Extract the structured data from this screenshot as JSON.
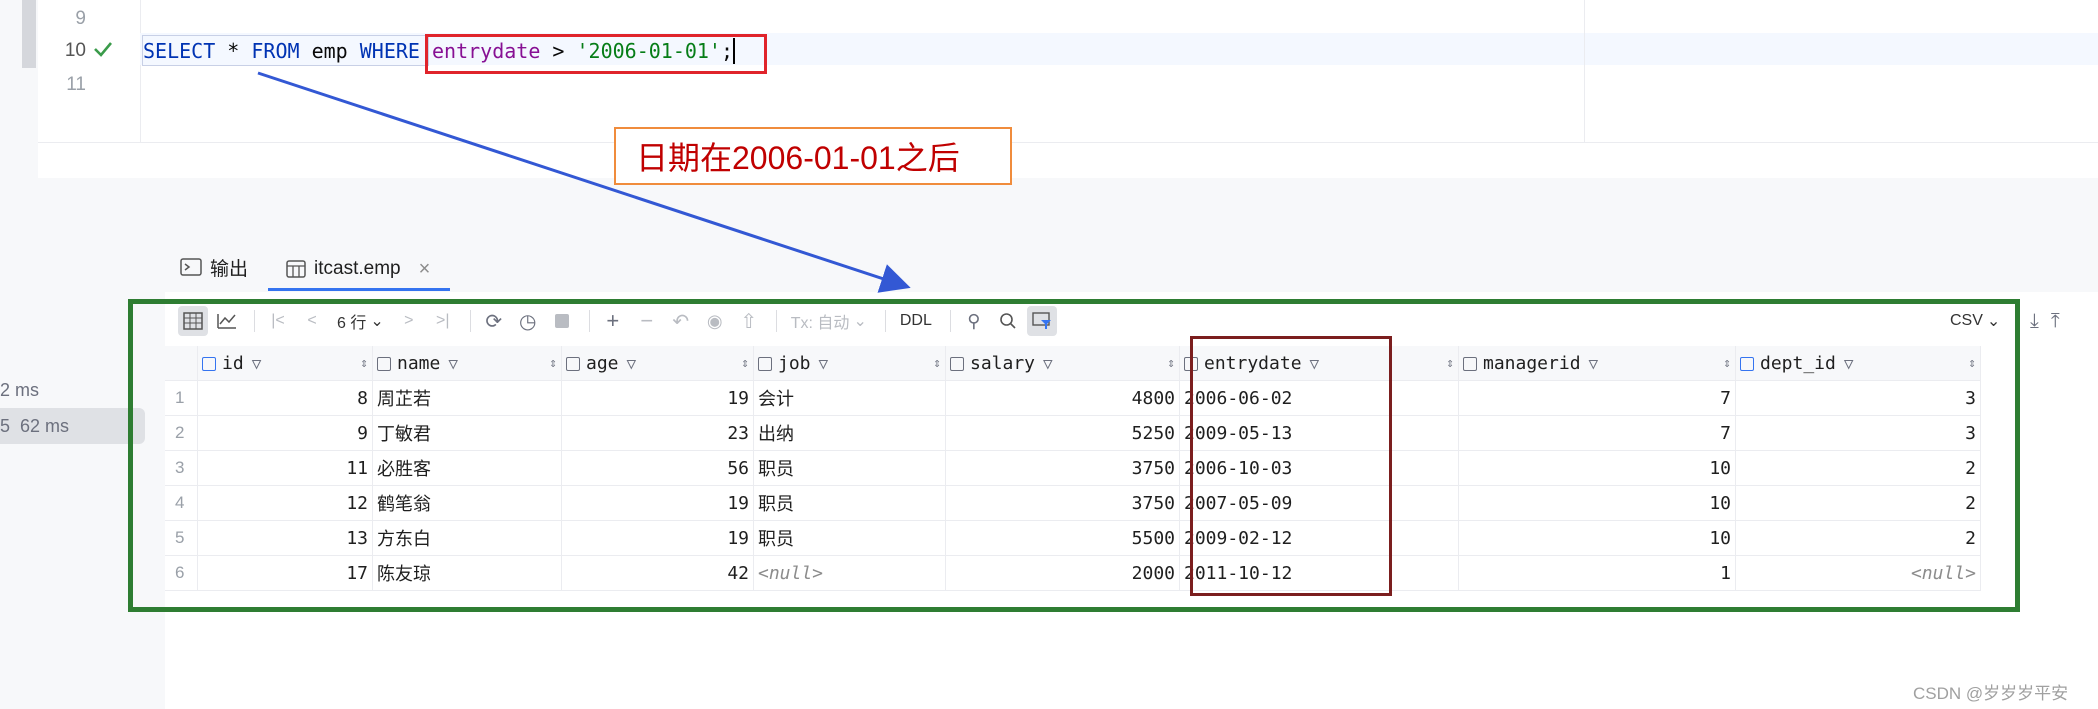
{
  "editor": {
    "line_numbers": [
      "9",
      "10",
      "11"
    ],
    "sql": {
      "kw_select": "SELECT",
      "star": " * ",
      "kw_from": "FROM",
      "table": " emp ",
      "kw_where": "WHERE",
      "column": "entrydate",
      "op": " > ",
      "literal": "'2006-01-01'",
      "semicolon": ";"
    },
    "run_status": "check-icon"
  },
  "annotation": {
    "text": "日期在2006-01-01之后"
  },
  "tabs": {
    "output_label": "输出",
    "result_label": "itcast.emp",
    "close_glyph": "×"
  },
  "side": {
    "time1": "2 ms",
    "time2": "5  62 ms"
  },
  "toolbar": {
    "rows_label": "6 行",
    "tx_label": "Tx: 自动",
    "ddl_label": "DDL",
    "export_label": "CSV"
  },
  "grid": {
    "columns": [
      {
        "name": "id",
        "key": "id"
      },
      {
        "name": "name",
        "key": "name"
      },
      {
        "name": "age",
        "key": "age"
      },
      {
        "name": "job",
        "key": "job"
      },
      {
        "name": "salary",
        "key": "salary"
      },
      {
        "name": "entrydate",
        "key": "entrydate"
      },
      {
        "name": "managerid",
        "key": "managerid"
      },
      {
        "name": "dept_id",
        "key": "dept_id"
      }
    ],
    "rows": [
      {
        "rn": "1",
        "id": "8",
        "name": "周芷若",
        "age": "19",
        "job": "会计",
        "salary": "4800",
        "entrydate": "2006-06-02",
        "managerid": "7",
        "dept_id": "3"
      },
      {
        "rn": "2",
        "id": "9",
        "name": "丁敏君",
        "age": "23",
        "job": "出纳",
        "salary": "5250",
        "entrydate": "2009-05-13",
        "managerid": "7",
        "dept_id": "3"
      },
      {
        "rn": "3",
        "id": "11",
        "name": "必胜客",
        "age": "56",
        "job": "职员",
        "salary": "3750",
        "entrydate": "2006-10-03",
        "managerid": "10",
        "dept_id": "2"
      },
      {
        "rn": "4",
        "id": "12",
        "name": "鹤笔翁",
        "age": "19",
        "job": "职员",
        "salary": "3750",
        "entrydate": "2007-05-09",
        "managerid": "10",
        "dept_id": "2"
      },
      {
        "rn": "5",
        "id": "13",
        "name": "方东白",
        "age": "19",
        "job": "职员",
        "salary": "5500",
        "entrydate": "2009-02-12",
        "managerid": "10",
        "dept_id": "2"
      },
      {
        "rn": "6",
        "id": "17",
        "name": "陈友琼",
        "age": "42",
        "job": "<null>",
        "salary": "2000",
        "entrydate": "2011-10-12",
        "managerid": "1",
        "dept_id": "<null>"
      }
    ]
  },
  "watermark": "CSDN @岁岁岁平安",
  "colors": {
    "keyword": "#0033b3",
    "column": "#871094",
    "string": "#067d17",
    "highlight_red": "#e0242b",
    "green_frame": "#2e7d32",
    "arrow_blue": "#3358d4"
  }
}
